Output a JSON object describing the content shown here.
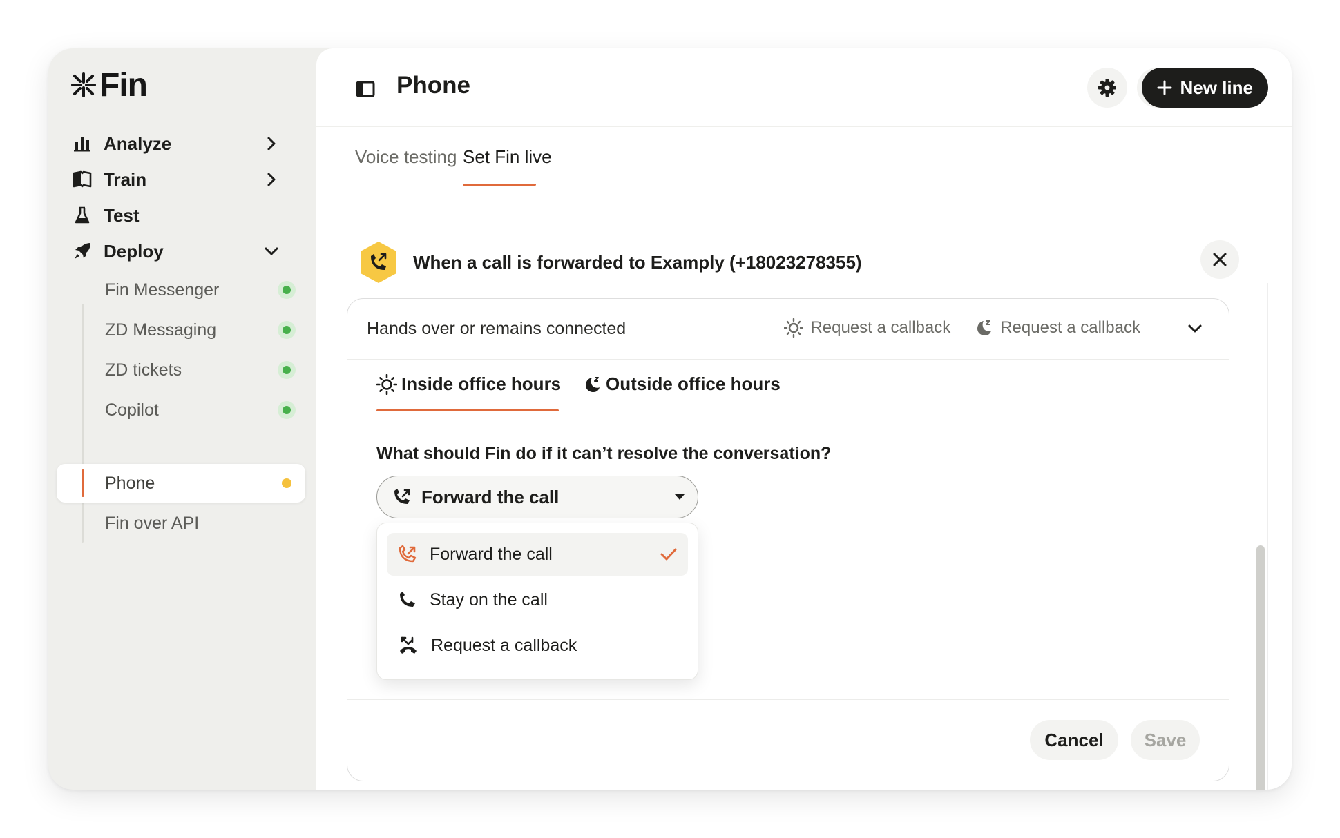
{
  "app": {
    "logo_text": "Fin"
  },
  "sidebar": {
    "items": [
      {
        "label": "Analyze",
        "icon": "bar-chart-icon",
        "expandable": true
      },
      {
        "label": "Train",
        "icon": "book-icon",
        "expandable": true
      },
      {
        "label": "Test",
        "icon": "flask-icon",
        "expandable": false
      },
      {
        "label": "Deploy",
        "icon": "rocket-icon",
        "expanded": true
      }
    ],
    "deploy_items": [
      {
        "label": "Fin Messenger",
        "status": "live"
      },
      {
        "label": "ZD Messaging",
        "status": "live"
      },
      {
        "label": "ZD tickets",
        "status": "live"
      },
      {
        "label": "Copilot",
        "status": "live"
      },
      {
        "label": "Phone",
        "status": "pending",
        "active": true
      },
      {
        "label": "Fin over API",
        "status": ""
      }
    ]
  },
  "header": {
    "title": "Phone",
    "new_line_label": "New line"
  },
  "tabs": [
    {
      "label": "Voice testing",
      "active": false
    },
    {
      "label": "Set Fin live",
      "active": true
    }
  ],
  "section": {
    "title": "When a call is forwarded to Examply (+18023278355)"
  },
  "card": {
    "title": "Hands over or remains connected",
    "summary_inside": "Request a callback",
    "summary_outside": "Request a callback",
    "inner_tabs": [
      {
        "label": "Inside office hours",
        "active": true
      },
      {
        "label": "Outside office hours",
        "active": false
      }
    ],
    "question": "What should Fin do if it can’t resolve the conversation?",
    "select_value": "Forward the call",
    "options": [
      {
        "label": "Forward the call",
        "icon": "phone-forward-icon",
        "selected": true
      },
      {
        "label": "Stay on the call",
        "icon": "phone-icon",
        "selected": false
      },
      {
        "label": "Request a callback",
        "icon": "phone-callback-icon",
        "selected": false
      }
    ],
    "cancel_label": "Cancel",
    "save_label": "Save"
  },
  "colors": {
    "accent": "#e06a3b",
    "live": "#47b04b",
    "pending": "#f5c13d",
    "section_icon_bg": "#f7c843"
  }
}
